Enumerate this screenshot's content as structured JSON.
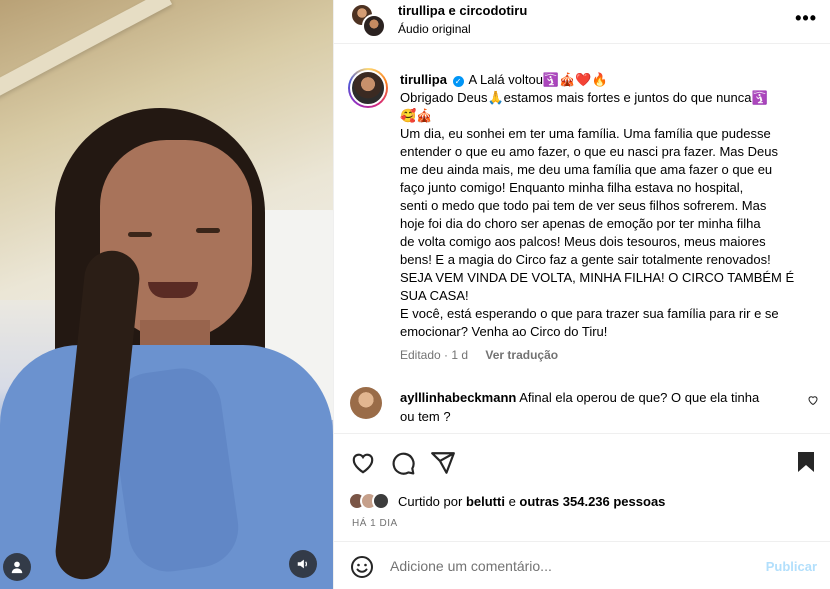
{
  "post": {
    "header": {
      "names": "tirullipa e circodotiru",
      "audio": "Áudio original",
      "more_icon": "more-horizontal-icon"
    },
    "caption": {
      "username": "tirullipa",
      "verified": true,
      "lines": [
        "A Lalá voltou🛐🎪❤️🔥",
        "Obrigado Deus🙏estamos mais fortes e juntos do que nunca🛐",
        "🥰🎪",
        "Um dia, eu sonhei em ter uma família. Uma família que pudesse",
        "entender o que eu amo fazer, o que eu nasci pra fazer. Mas Deus",
        "me deu ainda mais, me deu uma família que ama fazer o que eu",
        "faço junto comigo! Enquanto minha filha estava no hospital,",
        "senti o medo que todo pai tem de ver seus filhos sofrerem. Mas",
        "hoje foi dia do choro ser apenas de emoção por ter minha filha",
        "de volta comigo aos palcos! Meus dois tesouros, meus maiores",
        "bens! E a magia do Circo faz a gente sair totalmente renovados!",
        "SEJA VEM VINDA DE VOLTA, MINHA FILHA! O CIRCO TAMBÉM É",
        "SUA CASA!",
        "E você, está esperando o que para trazer sua família para rir e se",
        "emocionar? Venha ao Circo do Tiru!"
      ],
      "edited": "Editado · 1 d",
      "translate": "Ver tradução"
    },
    "comment": {
      "username": "aylllinhabeckmann",
      "text": "Afinal ela operou de que? O que ela tinha",
      "text2": "ou tem ?"
    },
    "likes": {
      "prefix": "Curtido por",
      "user": "belutti",
      "connector": "e",
      "others": "outras 354.236 pessoas"
    },
    "date": "HÁ 1 DIA",
    "add_comment": {
      "placeholder": "Adicione um comentário...",
      "publish": "Publicar"
    }
  },
  "colors": {
    "accent": "#0095f6",
    "publish_disabled": "#b2dffc",
    "muted": "#737373"
  }
}
